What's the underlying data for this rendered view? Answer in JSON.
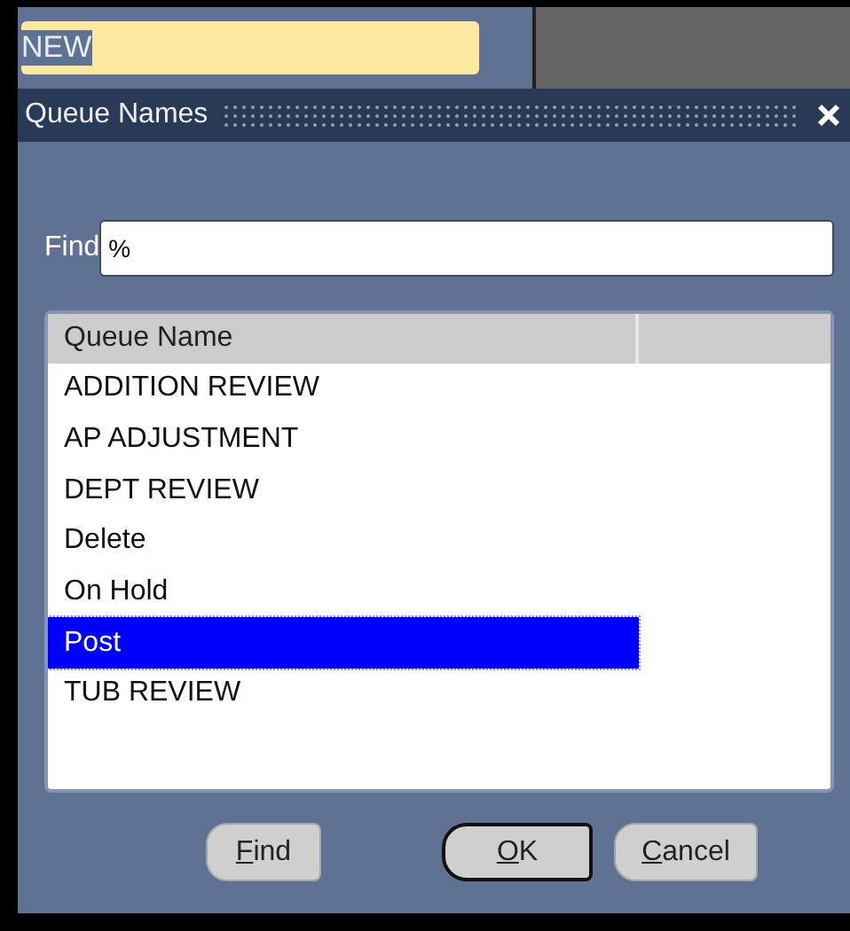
{
  "background_field": {
    "value": "NEW",
    "highlighted": true
  },
  "dialog": {
    "title": "Queue Names",
    "find": {
      "label": "Find",
      "value": "%"
    },
    "list": {
      "columns": [
        "Queue Name"
      ],
      "rows": [
        {
          "name": "ADDITION REVIEW",
          "selected": false
        },
        {
          "name": "AP ADJUSTMENT",
          "selected": false
        },
        {
          "name": "DEPT REVIEW",
          "selected": false
        },
        {
          "name": "Delete",
          "selected": false
        },
        {
          "name": "On Hold",
          "selected": false
        },
        {
          "name": "Post",
          "selected": true
        },
        {
          "name": "TUB REVIEW",
          "selected": false
        }
      ]
    },
    "buttons": [
      {
        "label": "Find",
        "default": false
      },
      {
        "label": "OK",
        "default": true
      },
      {
        "label": "Cancel",
        "default": false
      }
    ]
  }
}
